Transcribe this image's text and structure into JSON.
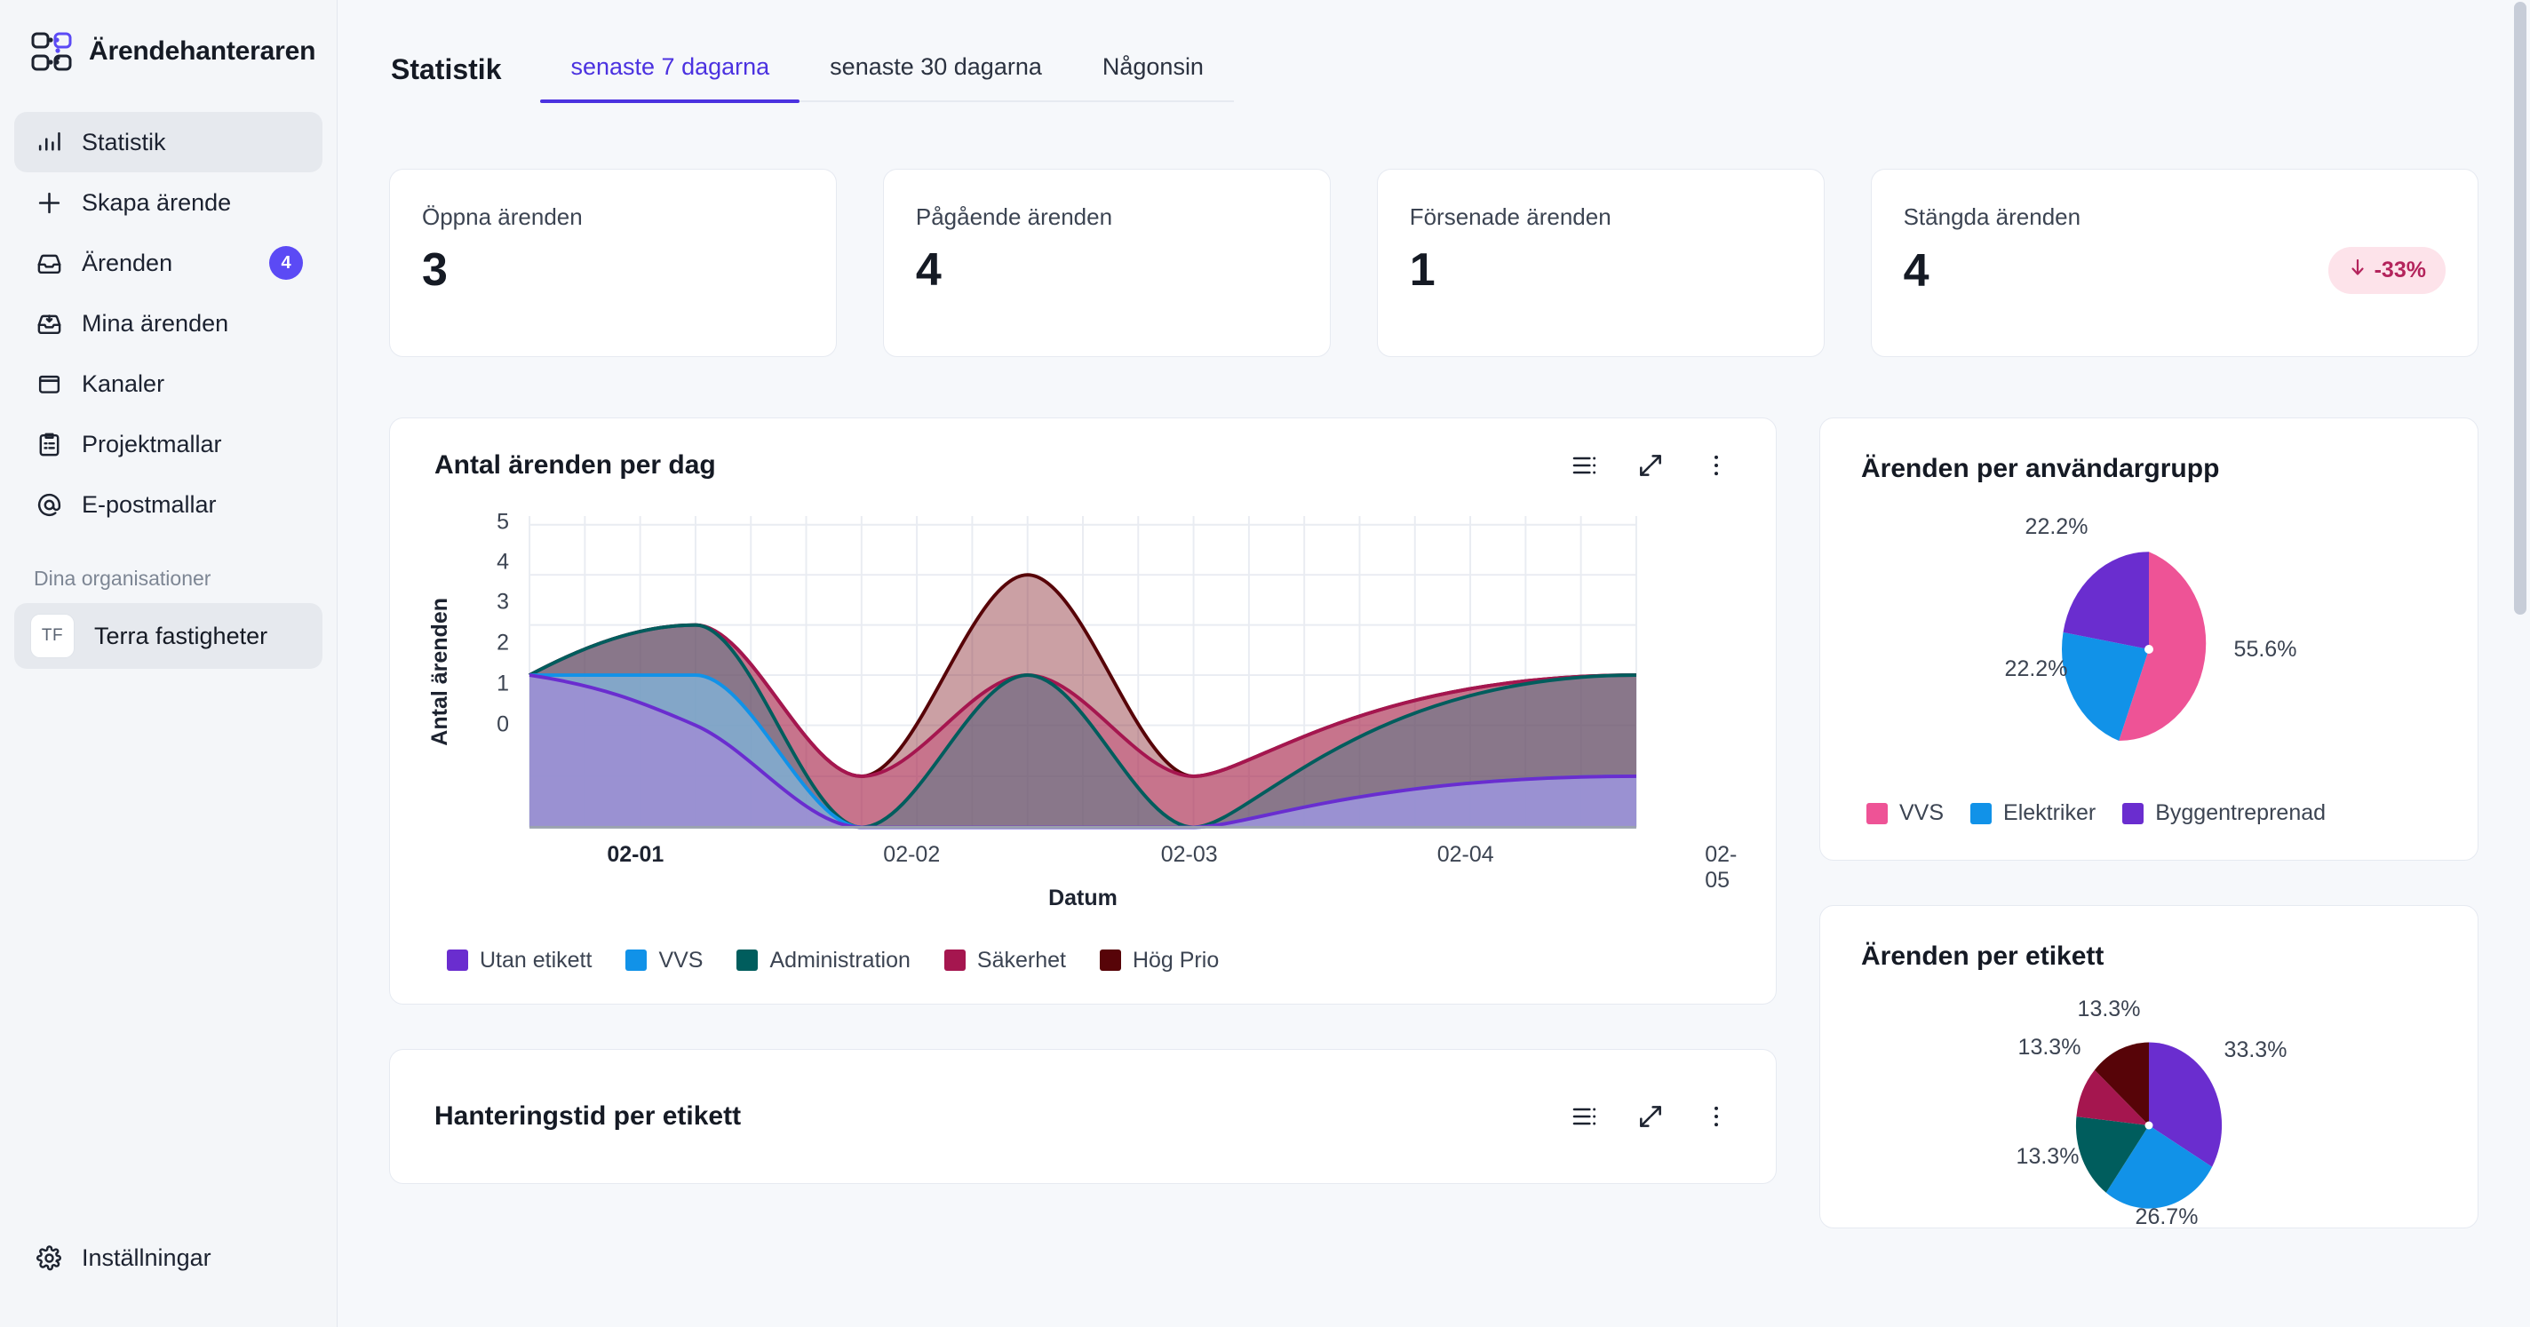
{
  "brand": {
    "name": "Ärendehanteraren",
    "logo_icon": "grid-nodes-logo-icon"
  },
  "sidebar": {
    "items": [
      {
        "label": "Statistik",
        "icon": "bar-chart-icon",
        "active": true,
        "badge": null
      },
      {
        "label": "Skapa ärende",
        "icon": "plus-icon",
        "active": false,
        "badge": null
      },
      {
        "label": "Ärenden",
        "icon": "inbox-icon",
        "active": false,
        "badge": "4"
      },
      {
        "label": "Mina ärenden",
        "icon": "inbox-download-icon",
        "active": false,
        "badge": null
      },
      {
        "label": "Kanaler",
        "icon": "archive-box-icon",
        "active": false,
        "badge": null
      },
      {
        "label": "Projektmallar",
        "icon": "clipboard-checklist-icon",
        "active": false,
        "badge": null
      },
      {
        "label": "E-postmallar",
        "icon": "at-sign-icon",
        "active": false,
        "badge": null
      }
    ],
    "org_header": "Dina organisationer",
    "org": {
      "initials": "TF",
      "name": "Terra fastigheter"
    },
    "settings": {
      "label": "Inställningar",
      "icon": "gear-icon"
    }
  },
  "header": {
    "page_title": "Statistik",
    "tabs": [
      {
        "label": "senaste 7 dagarna",
        "active": true
      },
      {
        "label": "senaste 30 dagarna",
        "active": false
      },
      {
        "label": "Någonsin",
        "active": false
      }
    ]
  },
  "kpis": [
    {
      "label": "Öppna ärenden",
      "value": "3",
      "delta": null
    },
    {
      "label": "Pågående ärenden",
      "value": "4",
      "delta": null
    },
    {
      "label": "Försenade ärenden",
      "value": "1",
      "delta": null
    },
    {
      "label": "Stängda ärenden",
      "value": "4",
      "delta": "-33%",
      "delta_icon": "arrow-down-icon",
      "delta_color": "#b4245c",
      "delta_bg": "#fde3ea"
    }
  ],
  "panels": {
    "area_chart": {
      "title": "Antal ärenden per dag"
    },
    "pie_usergroup": {
      "title": "Ärenden per användargrupp"
    },
    "pie_label": {
      "title": "Ärenden per etikett"
    },
    "handling_time": {
      "title": "Hanteringstid per etikett"
    },
    "actions": [
      {
        "name": "table-view-icon",
        "label": "Tabellvy"
      },
      {
        "name": "expand-icon",
        "label": "Expandera"
      },
      {
        "name": "more-vertical-icon",
        "label": "Mer"
      }
    ]
  },
  "chart_data": [
    {
      "type": "area",
      "title": "Antal ärenden per dag",
      "xlabel": "Datum",
      "ylabel": "Antal ärenden",
      "x": [
        "02-01",
        "02-02",
        "02-03",
        "02-04",
        "02-05"
      ],
      "ylim": [
        0,
        5.4
      ],
      "yticks": [
        0,
        1,
        2,
        3,
        4,
        5
      ],
      "grid": true,
      "legend_position": "bottom",
      "stacked": true,
      "series": [
        {
          "name": "Utan etikett",
          "color": "#6A2DCF",
          "values": [
            3,
            0,
            0,
            0,
            1
          ]
        },
        {
          "name": "VVS",
          "color": "#1192E8",
          "values": [
            3,
            0,
            0,
            0,
            1
          ]
        },
        {
          "name": "Administration",
          "color": "#005D5D",
          "values": [
            3,
            0,
            2,
            0,
            2
          ]
        },
        {
          "name": "Säkerhet",
          "color": "#A5164F",
          "values": [
            3,
            1,
            2,
            1,
            2
          ]
        },
        {
          "name": "Hög Prio",
          "color": "#570408",
          "values": [
            3,
            1,
            4,
            1,
            2
          ]
        }
      ]
    },
    {
      "type": "pie",
      "title": "Ärenden per användargrupp",
      "labels": [
        "VVS",
        "Elektriker",
        "Byggentreprenad"
      ],
      "values": [
        55.6,
        22.2,
        22.2
      ],
      "value_labels": [
        "55.6%",
        "22.2%",
        "22.2%"
      ],
      "colors": [
        "#EE5396",
        "#1192E8",
        "#6A2DCF"
      ],
      "legend_position": "bottom"
    },
    {
      "type": "pie",
      "title": "Ärenden per etikett",
      "labels": [
        "Utan etikett",
        "VVS",
        "Administration",
        "Säkerhet",
        "Hög Prio"
      ],
      "values": [
        33.3,
        26.7,
        13.3,
        13.3,
        13.3
      ],
      "value_labels": [
        "33.3%",
        "26.7%",
        "13.3%",
        "13.3%",
        "13.3%"
      ],
      "colors": [
        "#6A2DCF",
        "#1192E8",
        "#005D5D",
        "#A5164F",
        "#570408"
      ],
      "legend_position": "bottom"
    }
  ]
}
